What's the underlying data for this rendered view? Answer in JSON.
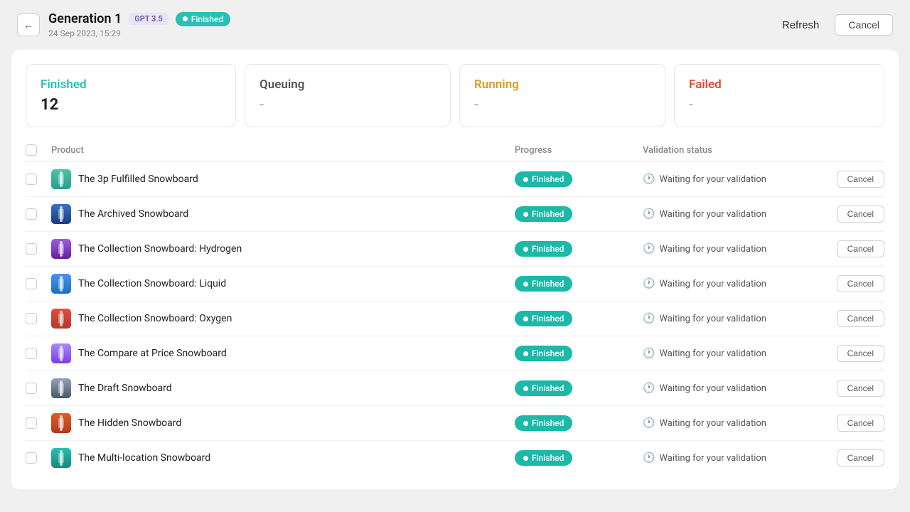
{
  "header": {
    "back_label": "←",
    "title": "Generation 1",
    "gpt_badge": "GPT 3.5",
    "status_label": "Finished",
    "date": "24 Sep 2023, 15:29",
    "refresh_label": "Refresh",
    "cancel_label": "Cancel"
  },
  "stats": {
    "finished": {
      "label": "Finished",
      "value": "12"
    },
    "queuing": {
      "label": "Queuing",
      "value": "-"
    },
    "running": {
      "label": "Running",
      "value": "-"
    },
    "failed": {
      "label": "Failed",
      "value": "-"
    }
  },
  "table": {
    "col_product": "Product",
    "col_progress": "Progress",
    "col_validation": "Validation status",
    "rows": [
      {
        "name": "The 3p Fulfilled Snowboard",
        "progress": "Finished",
        "validation": "Waiting for your validation",
        "color": "sb-green"
      },
      {
        "name": "The Archived Snowboard",
        "progress": "Finished",
        "validation": "Waiting for your validation",
        "color": "sb-blue-dark"
      },
      {
        "name": "The Collection Snowboard: Hydrogen",
        "progress": "Finished",
        "validation": "Waiting for your validation",
        "color": "sb-purple"
      },
      {
        "name": "The Collection Snowboard: Liquid",
        "progress": "Finished",
        "validation": "Waiting for your validation",
        "color": "sb-blue-light"
      },
      {
        "name": "The Collection Snowboard: Oxygen",
        "progress": "Finished",
        "validation": "Waiting for your validation",
        "color": "sb-red"
      },
      {
        "name": "The Compare at Price Snowboard",
        "progress": "Finished",
        "validation": "Waiting for your validation",
        "color": "sb-violet"
      },
      {
        "name": "The Draft Snowboard",
        "progress": "Finished",
        "validation": "Waiting for your validation",
        "color": "sb-slate"
      },
      {
        "name": "The Hidden Snowboard",
        "progress": "Finished",
        "validation": "Waiting for your validation",
        "color": "sb-orange-red"
      },
      {
        "name": "The Multi-location Snowboard",
        "progress": "Finished",
        "validation": "Waiting for your validation",
        "color": "sb-teal"
      }
    ],
    "cancel_label": "Cancel"
  }
}
